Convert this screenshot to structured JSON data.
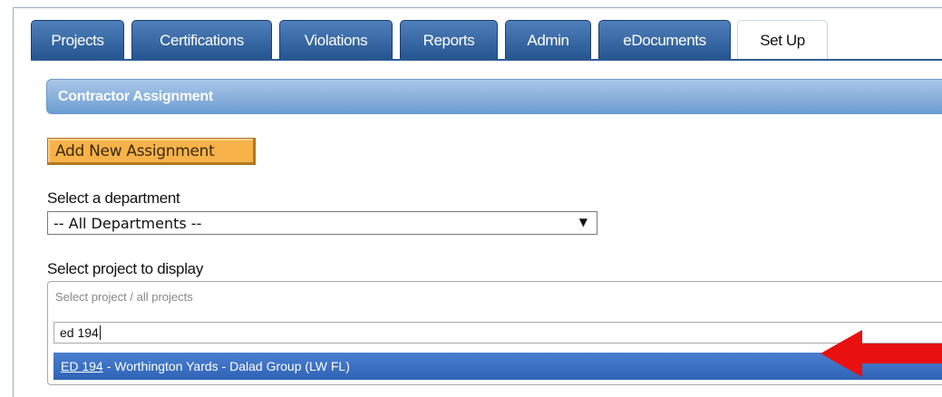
{
  "tabs": [
    {
      "label": "Projects",
      "active": false
    },
    {
      "label": "Certifications",
      "active": false
    },
    {
      "label": "Violations",
      "active": false
    },
    {
      "label": "Reports",
      "active": false
    },
    {
      "label": "Admin",
      "active": false
    },
    {
      "label": "eDocuments",
      "active": false
    },
    {
      "label": "Set Up",
      "active": true
    }
  ],
  "section": {
    "title": "Contractor Assignment"
  },
  "actions": {
    "add_assignment_label": "Add New Assignment"
  },
  "department": {
    "label": "Select a department",
    "selected": "-- All Departments --",
    "arrow": "▼"
  },
  "project": {
    "label": "Select project to display",
    "placeholder": "Select project / all projects",
    "search_value": "ed 194",
    "result": {
      "code": "ED 194",
      "rest": "- Worthington Yards - Dalad Group (LW FL)"
    }
  },
  "colors": {
    "tab_blue": "#2f5f9c",
    "header_blue": "#7fa9d9",
    "button_orange": "#f7b24a",
    "highlight_blue": "#3a6fc4",
    "arrow_red": "#e81010"
  },
  "icons": {
    "annotation": "red-arrow-icon"
  }
}
